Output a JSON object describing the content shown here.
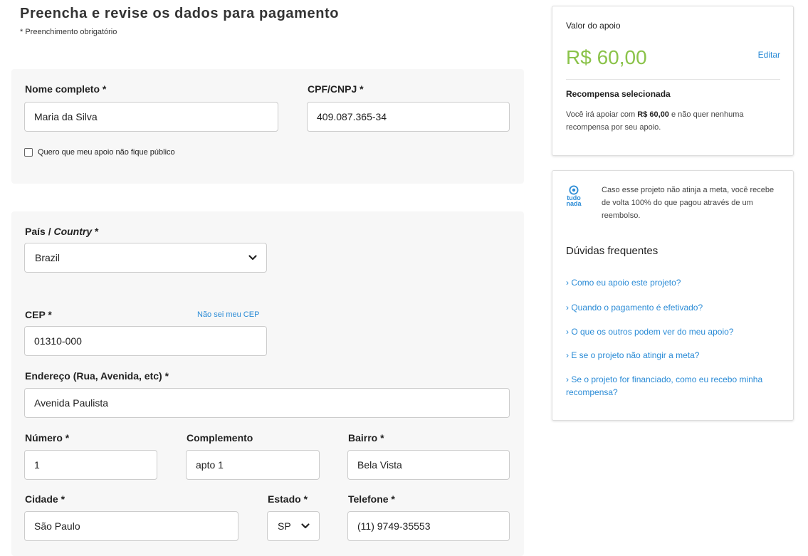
{
  "header": {
    "title": "Preencha e revise os dados para pagamento",
    "required_note": "* Preenchimento obrigatório"
  },
  "identity": {
    "name_label": "Nome completo *",
    "name_value": "Maria da Silva",
    "cpf_label": "CPF/CNPJ *",
    "cpf_value": "409.087.365-34",
    "anonymous_label": "Quero que meu apoio não fique público",
    "anonymous_checked": false
  },
  "address": {
    "country_label_prefix": "País / ",
    "country_label_italic": "Country",
    "country_label_suffix": " *",
    "country_value": "Brazil",
    "cep_label": "CEP *",
    "cep_link": "Não sei meu CEP",
    "cep_value": "01310-000",
    "street_label": "Endereço (Rua, Avenida, etc) *",
    "street_value": "Avenida Paulista",
    "number_label": "Número *",
    "number_value": "1",
    "complement_label": "Complemento",
    "complement_value": "apto 1",
    "district_label": "Bairro *",
    "district_value": "Bela Vista",
    "city_label": "Cidade *",
    "city_value": "São Paulo",
    "state_label": "Estado *",
    "state_value": "SP",
    "phone_label": "Telefone *",
    "phone_value": "(11) 9749-35553"
  },
  "summary": {
    "amount_label": "Valor do apoio",
    "amount_value": "R$ 60,00",
    "edit_label": "Editar",
    "reward_title": "Recompensa selecionada",
    "reward_text_before": "Você irá apoiar com ",
    "reward_amount": "R$ 60,00",
    "reward_text_after": " e não quer nenhuma recompensa por seu apoio."
  },
  "help": {
    "logo_text_1": "tudo",
    "logo_text_2": "nada",
    "guarantee_text": "Caso esse projeto não atinja a meta, você recebe de volta 100% do que pagou através de um reembolso.",
    "faq_title": "Dúvidas frequentes",
    "faq": [
      "› Como eu apoio este projeto?",
      "› Quando o pagamento é efetivado?",
      "› O que os outros podem ver do meu apoio?",
      "› E se o projeto não atingir a meta?",
      "› Se o projeto for financiado, como eu recebo minha recompensa?"
    ]
  },
  "colors": {
    "accent_green": "#8bc34a",
    "link_blue": "#2a8bd6",
    "panel_bg": "#f7f7f7"
  },
  "icons": {
    "select_arrow": "chevron-down-icon",
    "brand": "tudo-nada-logo-icon"
  }
}
